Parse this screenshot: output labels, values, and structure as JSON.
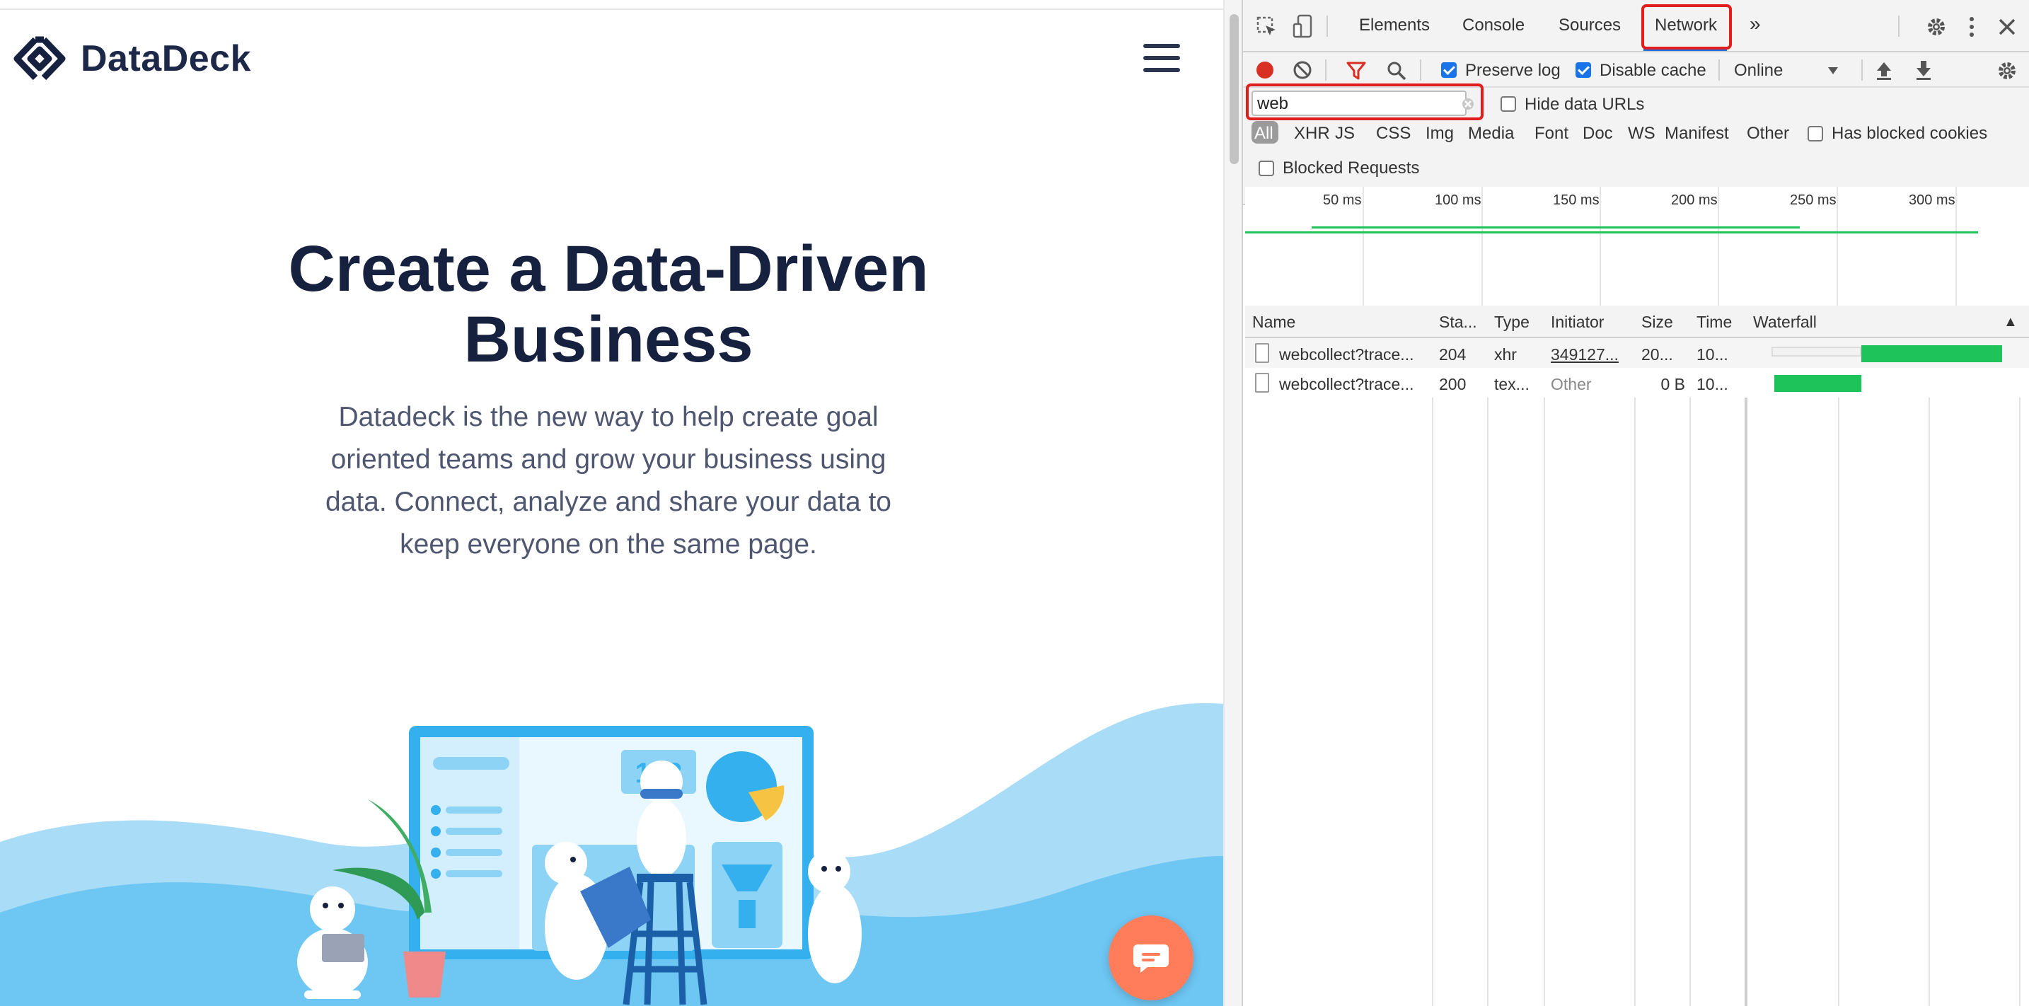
{
  "site": {
    "logo_text": "DataDeck",
    "hero_title": "Create a Data-Driven Business",
    "hero_subtitle": "Datadeck is the new way to help create goal oriented teams and grow your business using data. Connect, analyze and share your data to keep everyone on the same page.",
    "illustration_number": "123",
    "colors": {
      "navy": "#16213f",
      "sky_blue": "#6ec6f3",
      "accent_orange": "#ff7d5a",
      "screen_blue": "#34b0ef"
    },
    "icons": {
      "logo": "datadeck-logo-icon",
      "menu": "hamburger-menu-icon",
      "chat": "chat-bubble-icon"
    }
  },
  "devtools": {
    "tabs": [
      "Elements",
      "Console",
      "Sources",
      "Network"
    ],
    "active_tab": "Network",
    "more_tabs_label": "»",
    "toolbar": {
      "preserve_log": {
        "label": "Preserve log",
        "checked": true
      },
      "disable_cache": {
        "label": "Disable cache",
        "checked": true
      },
      "throttling": "Online"
    },
    "filter": {
      "value": "web",
      "hide_data_urls": {
        "label": "Hide data URLs",
        "checked": false
      },
      "types": [
        "All",
        "XHR",
        "JS",
        "CSS",
        "Img",
        "Media",
        "Font",
        "Doc",
        "WS",
        "Manifest",
        "Other"
      ],
      "active_type": "All",
      "has_blocked_cookies": {
        "label": "Has blocked cookies",
        "checked": false
      },
      "blocked_requests": {
        "label": "Blocked Requests",
        "checked": false
      }
    },
    "timeline": {
      "ticks": [
        "50 ms",
        "100 ms",
        "150 ms",
        "200 ms",
        "250 ms",
        "300 ms"
      ]
    },
    "columns": [
      "Name",
      "Sta...",
      "Type",
      "Initiator",
      "Size",
      "Time",
      "Waterfall"
    ],
    "sort_indicator": "▲",
    "requests": [
      {
        "name": "webcollect?trace...",
        "status": "204",
        "type": "xhr",
        "initiator": "349127...",
        "size": "20...",
        "time": "10..."
      },
      {
        "name": "webcollect?trace...",
        "status": "200",
        "type": "tex...",
        "initiator": "Other",
        "size": "0 B",
        "time": "10..."
      }
    ],
    "waterfall_fractions": [
      {
        "wait_start": 0.085,
        "wait_end": 0.405,
        "recv_start": 0.405,
        "recv_end": 0.905
      },
      {
        "wait_start": 0.095,
        "wait_end": 0.095,
        "recv_start": 0.095,
        "recv_end": 0.405
      }
    ],
    "colors": {
      "highlight": "#e11d1d",
      "record": "#d93025",
      "checkbox": "#1a73e8",
      "bar": "#1ec45a"
    },
    "icons": {
      "inspect": "inspect-element-icon",
      "device": "device-toolbar-icon",
      "settings": "gear-icon",
      "kebab": "kebab-menu-icon",
      "close": "close-icon",
      "record": "record-icon",
      "clear": "clear-icon",
      "filter": "filter-icon",
      "search": "search-icon",
      "import": "import-har-icon",
      "export": "export-har-icon",
      "dropdown": "dropdown-arrow-icon",
      "clear_filter": "clear-input-icon"
    }
  }
}
